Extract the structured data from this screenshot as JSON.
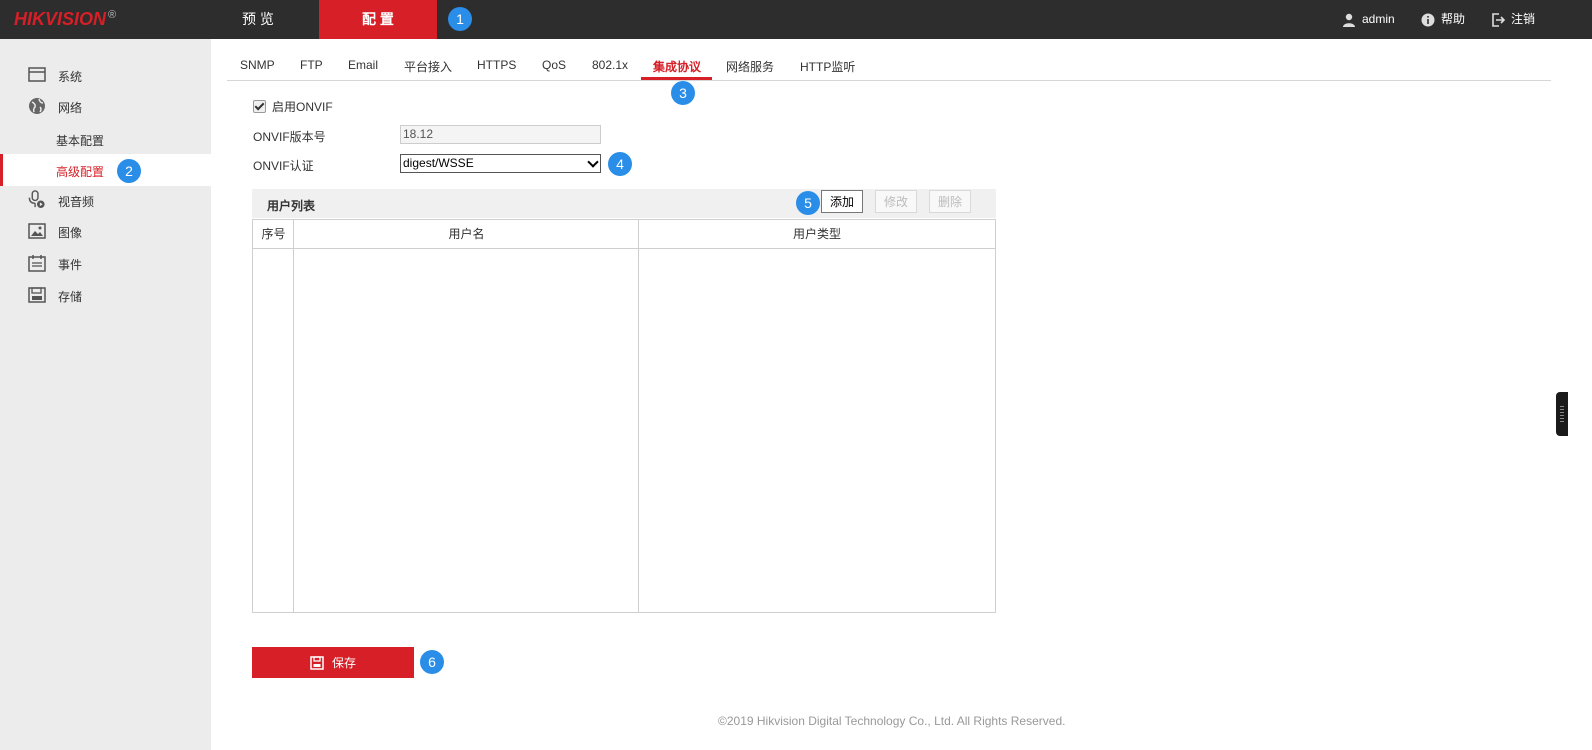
{
  "header": {
    "logo_text": "HIKVISION",
    "logo_mark": "®",
    "nav_tabs": [
      {
        "label": "预 览",
        "active": false
      },
      {
        "label": "配 置",
        "active": true
      }
    ],
    "user": {
      "icon": "user-icon",
      "label": "admin"
    },
    "help": {
      "icon": "help-icon",
      "label": "帮助"
    },
    "logout": {
      "icon": "logout-icon",
      "label": "注销"
    }
  },
  "sidebar": {
    "items": [
      {
        "icon": "system-icon",
        "label": "系统"
      },
      {
        "icon": "network-icon",
        "label": "网络"
      },
      {
        "label": "基本配置",
        "sub": true
      },
      {
        "label": "高级配置",
        "sub": true,
        "active": true
      },
      {
        "icon": "video-audio-icon",
        "label": "视音频"
      },
      {
        "icon": "image-icon",
        "label": "图像"
      },
      {
        "icon": "event-icon",
        "label": "事件"
      },
      {
        "icon": "storage-icon",
        "label": "存储"
      }
    ]
  },
  "subtabs": [
    {
      "label": "SNMP"
    },
    {
      "label": "FTP"
    },
    {
      "label": "Email"
    },
    {
      "label": "平台接入"
    },
    {
      "label": "HTTPS"
    },
    {
      "label": "QoS"
    },
    {
      "label": "802.1x"
    },
    {
      "label": "集成协议",
      "active": true
    },
    {
      "label": "网络服务"
    },
    {
      "label": "HTTP监听"
    }
  ],
  "form": {
    "enable_onvif": {
      "label": "启用ONVIF",
      "checked": true
    },
    "onvif_version": {
      "label": "ONVIF版本号",
      "value": "18.12"
    },
    "onvif_auth": {
      "label": "ONVIF认证",
      "value": "digest/WSSE"
    }
  },
  "user_table": {
    "title": "用户列表",
    "buttons": {
      "add": "添加",
      "modify": "修改",
      "delete": "删除"
    },
    "columns": [
      "序号",
      "用户名",
      "用户类型"
    ],
    "rows": []
  },
  "save_button": {
    "icon": "save-icon",
    "label": "保存"
  },
  "annotations": [
    "1",
    "2",
    "3",
    "4",
    "5",
    "6"
  ],
  "footer": "©2019 Hikvision Digital Technology Co., Ltd. All Rights Reserved.",
  "colors": {
    "brand_red": "#d61f26",
    "topbar": "#2d2d2d",
    "badge_blue": "#2a8de8",
    "sidebar_bg": "#ececec"
  }
}
